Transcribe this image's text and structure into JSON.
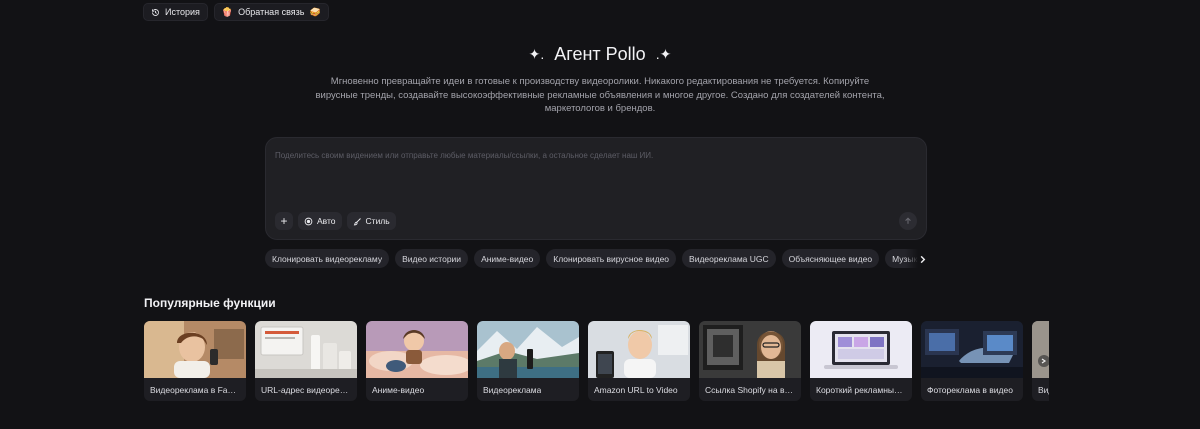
{
  "topbar": {
    "history_label": "История",
    "feedback_label": "Обратная связь",
    "feedback_emoji_left": "🍿",
    "feedback_emoji_right": "🥪"
  },
  "hero": {
    "sparkle_left": "✦.",
    "title": "Агент Pollo",
    "sparkle_right": ".✦",
    "subtitle": "Мгновенно превращайте идеи в готовые к производству видеоролики. Никакого редактирования не требуется. Копируйте вирусные тренды, создавайте высокоэффективные рекламные объявления и многое другое. Создано для создателей контента, маркетологов и брендов."
  },
  "composer": {
    "placeholder": "Поделитесь своим видением или отправьте любые материалы/ссылки, а остальное сделает наш ИИ.",
    "value": "",
    "add_label": "+",
    "auto_label": "Авто",
    "style_label": "Стиль"
  },
  "chips": [
    "Клонировать видеорекламу",
    "Видео истории",
    "Аниме-видео",
    "Клонировать вирусное видео",
    "Видеореклама UGC",
    "Объясняющее видео",
    "Музыкальное видео"
  ],
  "section": {
    "title": "Популярные функции"
  },
  "cards": [
    {
      "label": "Видеореклама в Facebook",
      "thumb": "woman-product"
    },
    {
      "label": "URL-адрес видеорекламы",
      "thumb": "cosmetics"
    },
    {
      "label": "Аниме-видео",
      "thumb": "anime-boy"
    },
    {
      "label": "Видеореклама",
      "thumb": "man-camera"
    },
    {
      "label": "Amazon URL to Video",
      "thumb": "man-phone"
    },
    {
      "label": "Ссылка Shopify на видео",
      "thumb": "woman-glasses"
    },
    {
      "label": "Короткий рекламный ролик",
      "thumb": "laptop"
    },
    {
      "label": "Фотореклама в видео",
      "thumb": "car-dark"
    },
    {
      "label": "Вид",
      "thumb": "partial"
    }
  ],
  "colors": {
    "background": "#121215",
    "surface": "#202024",
    "chip": "#24242a",
    "text_primary": "#f2f2f5",
    "text_secondary": "#a3a3ab"
  },
  "icons": {
    "history": "history-icon",
    "auto": "auto-icon",
    "style": "brush-icon",
    "send": "arrow-up-icon",
    "chips_next": "chevron-right-icon"
  }
}
